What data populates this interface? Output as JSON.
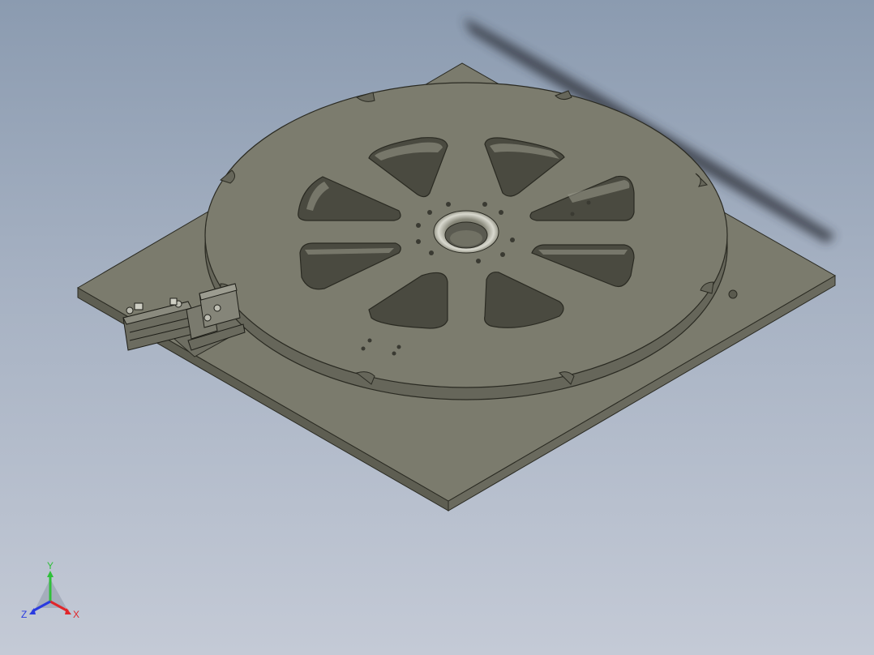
{
  "viewport": {
    "background_top": "#8b9bb0",
    "background_bottom": "#c4cad6",
    "model_color": "#7a7a6c",
    "edge_color": "#2a2a22"
  },
  "orientation_triad": {
    "x_label": "X",
    "y_label": "Y",
    "z_label": "Z",
    "x_color": "#e0262a",
    "y_color": "#2fbf3a",
    "z_color": "#2a3be0"
  }
}
